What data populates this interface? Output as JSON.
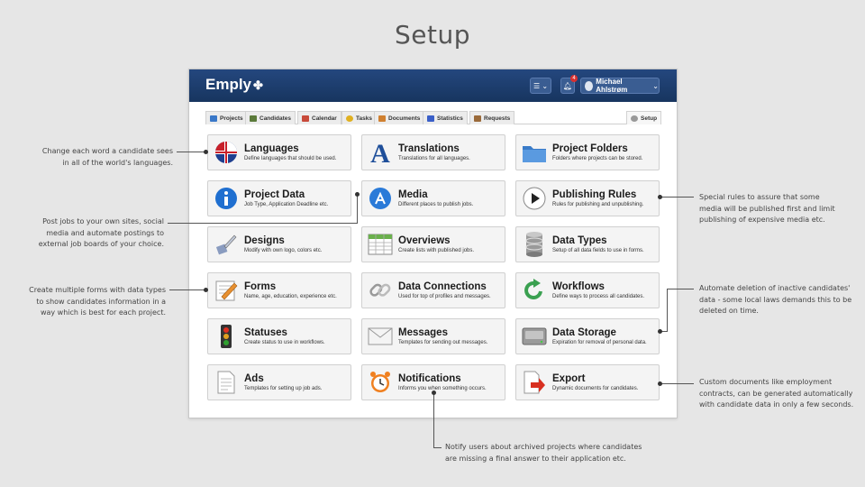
{
  "page_title": "Setup",
  "app": {
    "logo": "Emply",
    "user_name": "Michael Ahlstrøm",
    "notification_count": "4",
    "tabs": [
      {
        "label": "Projects",
        "color": "#3a78c8"
      },
      {
        "label": "Candidates",
        "color": "#5b7a3a"
      },
      {
        "label": "Calendar",
        "color": "#c84a3a"
      },
      {
        "label": "Tasks",
        "color": "#e0b020"
      },
      {
        "label": "Documents",
        "color": "#d08030"
      },
      {
        "label": "Statistics",
        "color": "#3a5fc8"
      },
      {
        "label": "Requests",
        "color": "#9a6a3a"
      }
    ],
    "setup_tab": "Setup"
  },
  "tiles": [
    {
      "title": "Languages",
      "desc": "Define languages that should be used.",
      "icon": "flag-globe-icon"
    },
    {
      "title": "Translations",
      "desc": "Translations for all languages.",
      "icon": "letter-a-icon"
    },
    {
      "title": "Project Folders",
      "desc": "Folders where projects can be stored.",
      "icon": "folder-icon"
    },
    {
      "title": "Project Data",
      "desc": "Job Type, Application Deadline etc.",
      "icon": "info-icon"
    },
    {
      "title": "Media",
      "desc": "Different places to publish jobs.",
      "icon": "app-store-icon"
    },
    {
      "title": "Publishing Rules",
      "desc": "Rules for publishing and unpublishing.",
      "icon": "play-icon"
    },
    {
      "title": "Designs",
      "desc": "Modify with own logo, colors etc.",
      "icon": "paint-brush-icon"
    },
    {
      "title": "Overviews",
      "desc": "Create lists with published jobs.",
      "icon": "spreadsheet-icon"
    },
    {
      "title": "Data Types",
      "desc": "Setup of all data fields to use in forms.",
      "icon": "database-icon"
    },
    {
      "title": "Forms",
      "desc": "Name, age, education, experience etc.",
      "icon": "form-pencil-icon"
    },
    {
      "title": "Data Connections",
      "desc": "Used for top of profiles and messages.",
      "icon": "chain-link-icon"
    },
    {
      "title": "Workflows",
      "desc": "Define ways to process all candidates.",
      "icon": "refresh-arrow-icon"
    },
    {
      "title": "Statuses",
      "desc": "Create status to use in workflows.",
      "icon": "traffic-light-icon"
    },
    {
      "title": "Messages",
      "desc": "Templates for sending out messages.",
      "icon": "envelope-icon"
    },
    {
      "title": "Data Storage",
      "desc": "Expiration for removal of personal data.",
      "icon": "hard-drive-icon"
    },
    {
      "title": "Ads",
      "desc": "Templates for setting up job ads.",
      "icon": "document-icon"
    },
    {
      "title": "Notifications",
      "desc": "Informs you when something occurs.",
      "icon": "alarm-clock-icon"
    },
    {
      "title": "Export",
      "desc": "Dynamic documents for candidates.",
      "icon": "export-arrow-icon"
    }
  ],
  "annotations": {
    "languages": [
      "Change each word a candidate sees",
      "in all of the world's languages."
    ],
    "media": [
      "Post jobs to your own sites, social",
      "media and automate postings to",
      "external job boards of your choice."
    ],
    "forms": [
      "Create multiple forms with data types",
      "to show candidates information in a",
      "way which is best for each project."
    ],
    "publishing": [
      "Special rules to assure that some",
      "media will be published first and limit",
      "publishing of expensive media etc."
    ],
    "storage": [
      "Automate deletion of inactive candidates'",
      "data - some local laws demands this to be",
      "deleted on time."
    ],
    "export": [
      "Custom documents like employment",
      "contracts, can be generated automatically",
      "with candidate data in only a few seconds."
    ],
    "notifications": [
      "Notify users about archived projects where candidates",
      "are missing a final answer to their application etc."
    ]
  }
}
